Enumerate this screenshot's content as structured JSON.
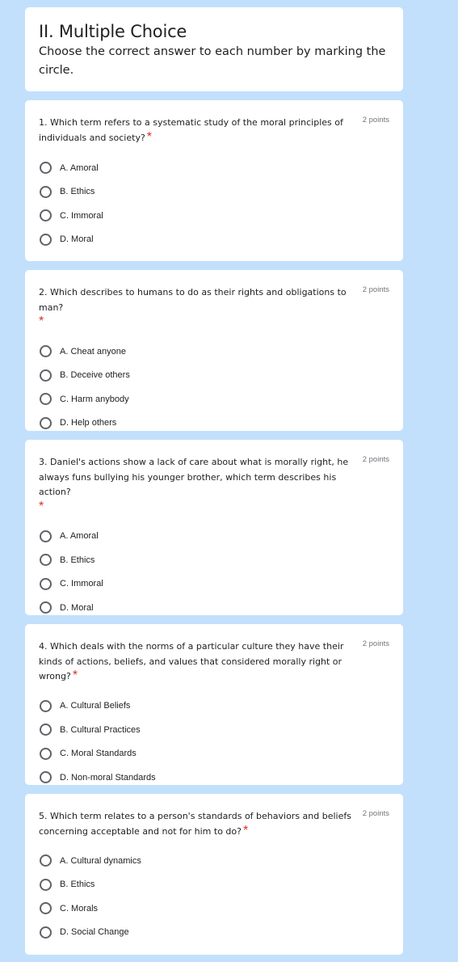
{
  "section": {
    "title": "II. Multiple Choice",
    "description": "Choose the correct answer to each number by marking the circle."
  },
  "colors": {
    "background": "#c2e0fc",
    "card": "#ffffff",
    "required": "#d93025"
  },
  "questions": [
    {
      "text": "1. Which term refers to a systematic study of the moral principles of individuals and society?",
      "required": "*",
      "points": "2 points",
      "options": [
        "A. Amoral",
        "B. Ethics",
        "C. Immoral",
        "D. Moral"
      ]
    },
    {
      "text": "2. Which describes to humans to do as their rights and obligations to man?",
      "required": "*",
      "points": "2 points",
      "options": [
        "A. Cheat anyone",
        "B. Deceive others",
        "C. Harm anybody",
        "D. Help others"
      ]
    },
    {
      "text": "3. Daniel's actions show a lack of care about what is morally right, he always funs bullying his younger brother, which term describes his action?",
      "required": "*",
      "points": "2 points",
      "options": [
        "A. Amoral",
        "B. Ethics",
        "C. Immoral",
        "D. Moral"
      ]
    },
    {
      "text": "4. Which deals with the norms of a particular culture they have their kinds of actions, beliefs, and values that considered morally right or wrong?",
      "required": "*",
      "points": "2 points",
      "options": [
        "A. Cultural Beliefs",
        "B. Cultural Practices",
        "C. Moral Standards",
        "D. Non-moral Standards"
      ]
    },
    {
      "text": "5. Which term relates to a person's standards of behaviors and beliefs concerning acceptable and not for him to do?",
      "required": "*",
      "points": "2 points",
      "options": [
        "A. Cultural dynamics",
        "B. Ethics",
        "C. Morals",
        "D. Social Change"
      ]
    }
  ]
}
